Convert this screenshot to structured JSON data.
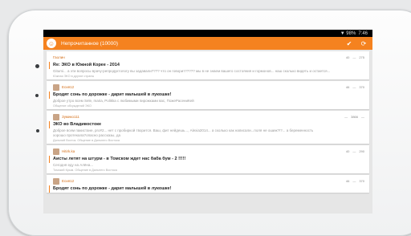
{
  "status": {
    "signal": "▼ 98%",
    "time": "7:46"
  },
  "app": {
    "title": "Непрочитанное (10000)",
    "check_icon": "check-icon",
    "refresh_icon": "refresh-icon"
  },
  "topics": [
    {
      "author": "Гаолин",
      "stats": [
        "40",
        "—",
        "275"
      ],
      "title": "Re: ЭКО в Южной Корее - 2014",
      "body": "Gitumi... а эти вопросы врачу-репродуктологу вы задавали???? что он говорит????? мы в не знаем вашего состояния и гормонов... наш сколько видеть и остается...",
      "body2": "",
      "foot": "Южная ЭКО в другие страны"
    },
    {
      "author": "Есия12",
      "stats": [
        "46",
        "—",
        "370"
      ],
      "title": "Бродят сонь по дорожке - дарит малышей в лукошке!",
      "body": "Доброе утро всем Sele, maria, Polikka с любимыми пирожками вас, ПожеРасениКей",
      "body2": "",
      "foot": "Общение обсуждений ЭКО"
    },
    {
      "author": "Зумико111",
      "stats": [
        "—",
        "3866",
        "—"
      ],
      "title": "ЭКО во Владивостоке",
      "body": "Доброе всем пакистане, pro#2... нет с пробиркой творится. Ваш, фит нейдешь..., Alexia2014... а сколько как написали...поля не ошиж?!?... а беременность",
      "body2": "хорошо протекала?опасно рассказы, да",
      "foot": "Дальний Восток. Общение в Дальнего Востока"
    },
    {
      "author": "Hitirk.ka",
      "stats": [
        "40",
        "—",
        "290"
      ],
      "title": "Аисты летят на штурм - в Томском ждет нас баба бум - 2 !!!!!",
      "body": "Сегодня еду на Алёна...",
      "body2": "",
      "foot": "Томский Крым. Общение в Дальнего Востока"
    },
    {
      "author": "Есия12",
      "stats": [
        "46",
        "—",
        "370"
      ],
      "title": "Бродят сонь по дорожке - дарит малышей в лукошке!",
      "body": "",
      "body2": "",
      "foot": ""
    }
  ]
}
